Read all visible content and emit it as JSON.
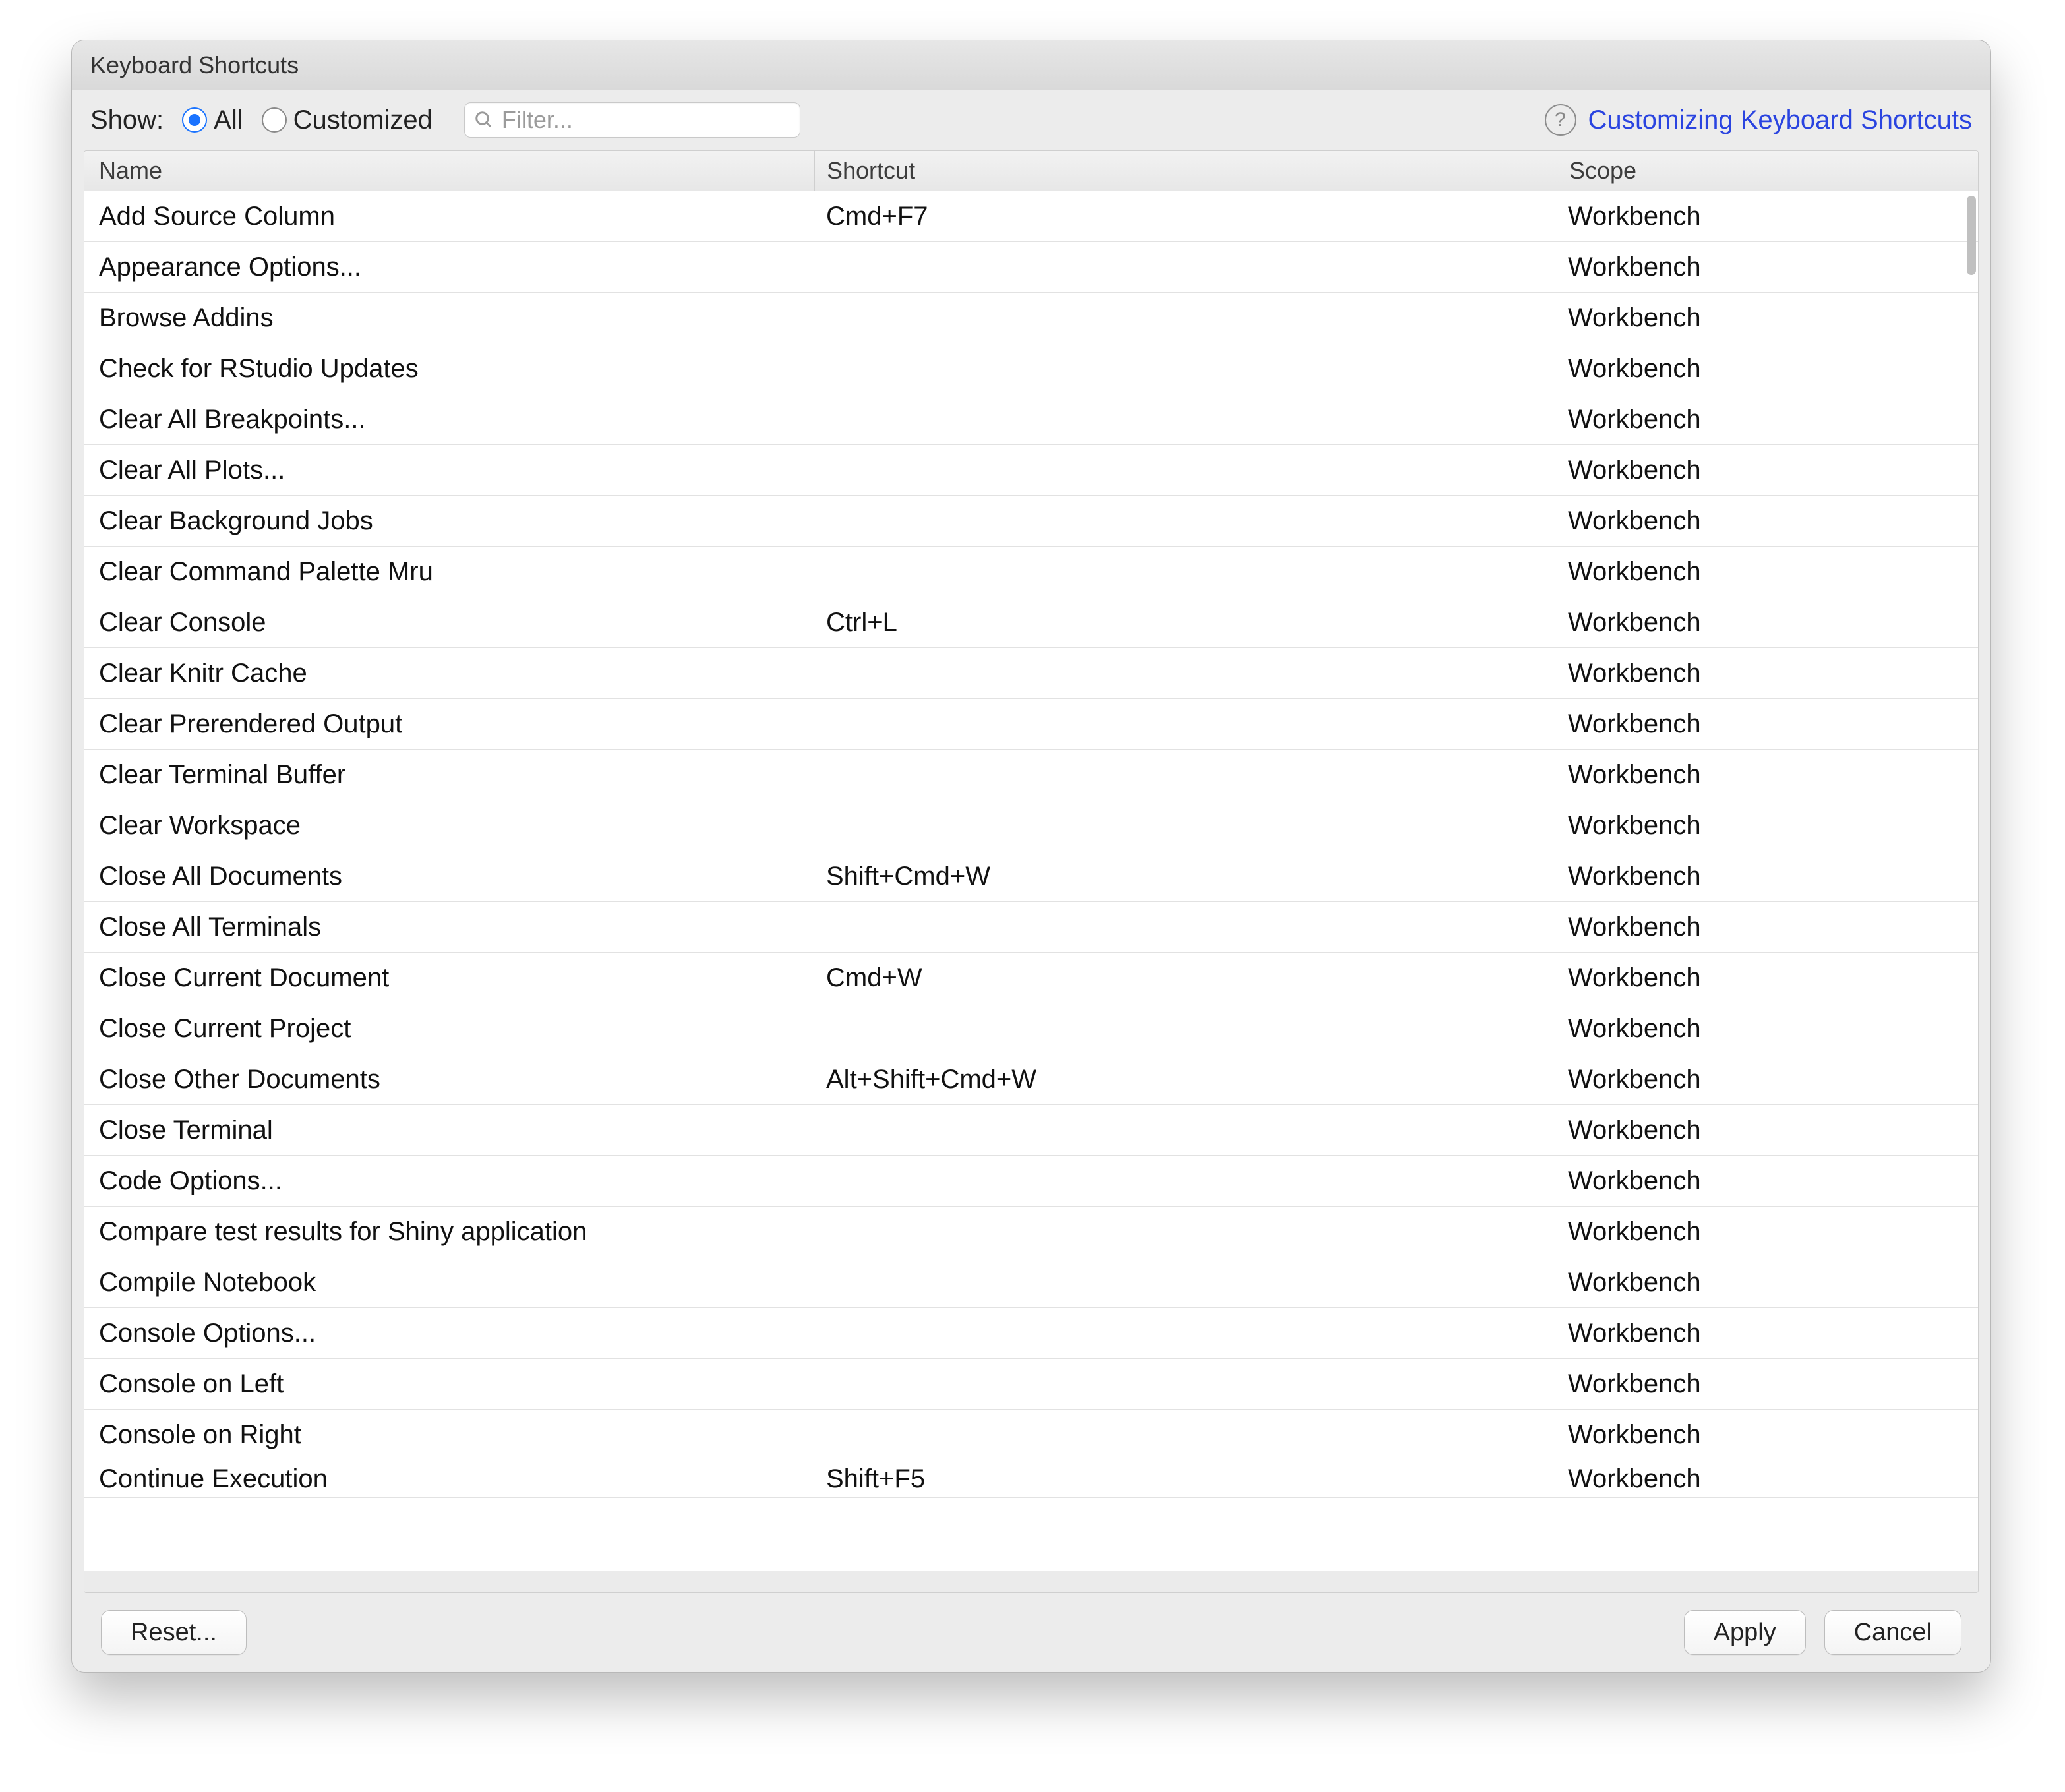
{
  "dialog": {
    "title": "Keyboard Shortcuts"
  },
  "toolbar": {
    "show_label": "Show:",
    "radio_all": "All",
    "radio_customized": "Customized",
    "filter_placeholder": "Filter...",
    "help_link": "Customizing Keyboard Shortcuts",
    "help_glyph": "?"
  },
  "columns": {
    "name": "Name",
    "shortcut": "Shortcut",
    "scope": "Scope"
  },
  "rows": [
    {
      "name": "Add Source Column",
      "shortcut": "Cmd+F7",
      "scope": "Workbench"
    },
    {
      "name": "Appearance Options...",
      "shortcut": "",
      "scope": "Workbench"
    },
    {
      "name": "Browse Addins",
      "shortcut": "",
      "scope": "Workbench"
    },
    {
      "name": "Check for RStudio Updates",
      "shortcut": "",
      "scope": "Workbench"
    },
    {
      "name": "Clear All Breakpoints...",
      "shortcut": "",
      "scope": "Workbench"
    },
    {
      "name": "Clear All Plots...",
      "shortcut": "",
      "scope": "Workbench"
    },
    {
      "name": "Clear Background Jobs",
      "shortcut": "",
      "scope": "Workbench"
    },
    {
      "name": "Clear Command Palette Mru",
      "shortcut": "",
      "scope": "Workbench"
    },
    {
      "name": "Clear Console",
      "shortcut": "Ctrl+L",
      "scope": "Workbench"
    },
    {
      "name": "Clear Knitr Cache",
      "shortcut": "",
      "scope": "Workbench"
    },
    {
      "name": "Clear Prerendered Output",
      "shortcut": "",
      "scope": "Workbench"
    },
    {
      "name": "Clear Terminal Buffer",
      "shortcut": "",
      "scope": "Workbench"
    },
    {
      "name": "Clear Workspace",
      "shortcut": "",
      "scope": "Workbench"
    },
    {
      "name": "Close All Documents",
      "shortcut": "Shift+Cmd+W",
      "scope": "Workbench"
    },
    {
      "name": "Close All Terminals",
      "shortcut": "",
      "scope": "Workbench"
    },
    {
      "name": "Close Current Document",
      "shortcut": "Cmd+W",
      "scope": "Workbench"
    },
    {
      "name": "Close Current Project",
      "shortcut": "",
      "scope": "Workbench"
    },
    {
      "name": "Close Other Documents",
      "shortcut": "Alt+Shift+Cmd+W",
      "scope": "Workbench"
    },
    {
      "name": "Close Terminal",
      "shortcut": "",
      "scope": "Workbench"
    },
    {
      "name": "Code Options...",
      "shortcut": "",
      "scope": "Workbench"
    },
    {
      "name": "Compare test results for Shiny application",
      "shortcut": "",
      "scope": "Workbench"
    },
    {
      "name": "Compile Notebook",
      "shortcut": "",
      "scope": "Workbench"
    },
    {
      "name": "Console Options...",
      "shortcut": "",
      "scope": "Workbench"
    },
    {
      "name": "Console on Left",
      "shortcut": "",
      "scope": "Workbench"
    },
    {
      "name": "Console on Right",
      "shortcut": "",
      "scope": "Workbench"
    },
    {
      "name": "Continue Execution",
      "shortcut": "Shift+F5",
      "scope": "Workbench"
    }
  ],
  "footer": {
    "reset": "Reset...",
    "apply": "Apply",
    "cancel": "Cancel"
  }
}
